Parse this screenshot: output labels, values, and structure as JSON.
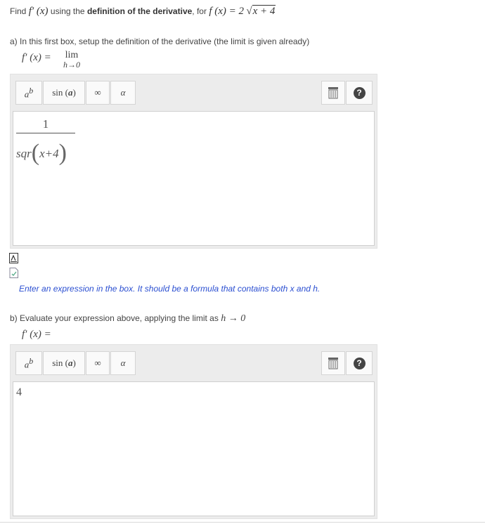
{
  "question": {
    "prefix": "Find",
    "fprime": "f′ (x)",
    "middle": "using the",
    "bold": "definition of the derivative",
    "for_text": ", for",
    "function_lhs": "f (x) = 2",
    "function_radicand": "x + 4"
  },
  "part_a": {
    "label": "a) In this first box, setup the definition of the derivative (the limit is given already)",
    "lhs": "f′ (x) =",
    "lim": "lim",
    "lim_sub": "h→0",
    "answer": {
      "numerator": "1",
      "den_func": "sqr",
      "den_arg": "x+4"
    },
    "hint": "Enter an expression in the box.  It should be a formula that contains both x and h."
  },
  "part_b": {
    "label": "b) Evaluate your expression above, applying the limit as",
    "label_math": "h → 0",
    "lhs": "f′ (x) =",
    "answer": "4"
  },
  "toolbar": {
    "power_base": "a",
    "power_exp": "b",
    "sin_func": "sin",
    "sin_arg": "a",
    "infinity": "∞",
    "alpha": "α",
    "help": "?"
  },
  "icons": [
    "power-icon",
    "sin-icon",
    "infinity-icon",
    "alpha-icon",
    "keyboard-icon",
    "help-icon",
    "math-check-icon",
    "file-check-icon"
  ],
  "colors": {
    "hint": "#2b4fd1",
    "toolbar_bg": "#ececec"
  }
}
